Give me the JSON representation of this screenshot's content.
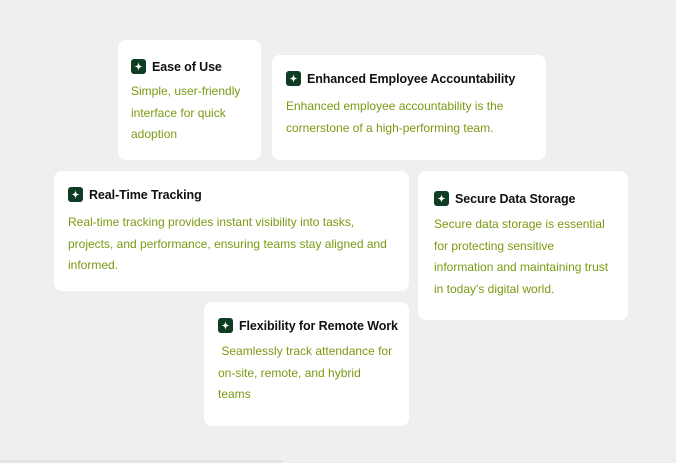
{
  "colors": {
    "background": "#efefef",
    "card": "#ffffff",
    "icon_bg": "#0f3d24",
    "title": "#111111",
    "text": "#7a9a12"
  },
  "cards": [
    {
      "icon": "sparkle-icon",
      "title": "Ease of Use",
      "text": "Simple, user-friendly interface for quick adoption"
    },
    {
      "icon": "sparkle-icon",
      "title": "Enhanced Employee Accountability",
      "text": "Enhanced employee accountability is the cornerstone of a high-performing team."
    },
    {
      "icon": "sparkle-icon",
      "title": "Real-Time Tracking",
      "text": "Real-time tracking provides instant visibility into tasks, projects, and performance, ensuring teams stay aligned and informed."
    },
    {
      "icon": "sparkle-icon",
      "title": "Secure Data Storage",
      "text": "Secure data storage is essential for protecting sensitive information and maintaining trust in today's digital world."
    },
    {
      "icon": "sparkle-icon",
      "title": "Flexibility for Remote Work",
      "text": " Seamlessly track attendance for on-site, remote, and hybrid teams"
    }
  ]
}
